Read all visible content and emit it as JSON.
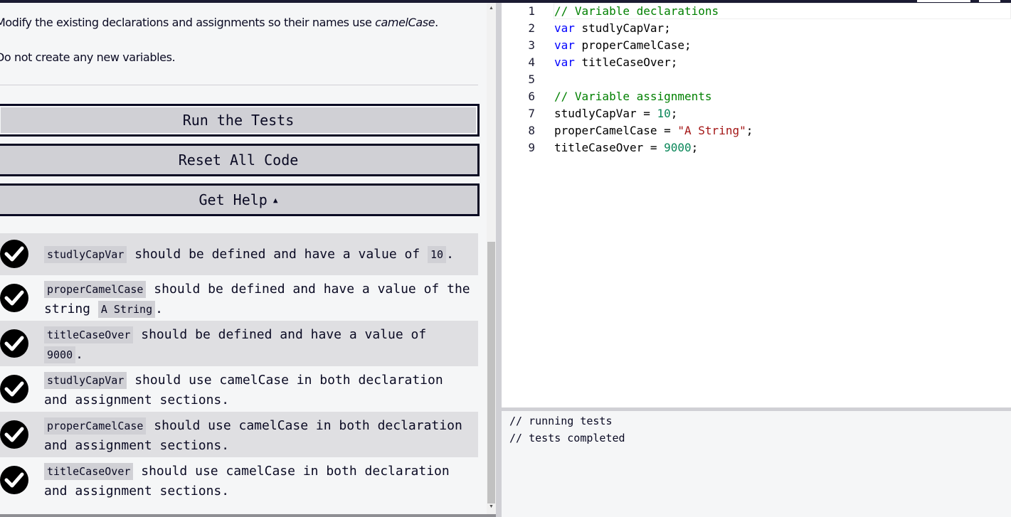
{
  "description": {
    "line1_prefix": "Modify the existing declarations and assignments so their names use ",
    "line1_em": "camelCase",
    "line1_suffix": ".",
    "line2": "Do not create any new variables."
  },
  "buttons": {
    "run": "Run the Tests",
    "reset": "Reset All Code",
    "help": "Get Help",
    "help_caret": "▲"
  },
  "tests": [
    {
      "status": "passed",
      "code1": "studlyCapVar",
      "text1": " should be defined and have a value of ",
      "code2": "10",
      "text2": "."
    },
    {
      "status": "passed",
      "code1": "properCamelCase",
      "text1": " should be defined and have a value of the string ",
      "code2": "A String",
      "text2": "."
    },
    {
      "status": "passed",
      "code1": "titleCaseOver",
      "text1": " should be defined and have a value of ",
      "code2": "9000",
      "text2": "."
    },
    {
      "status": "passed",
      "code1": "studlyCapVar",
      "text1": " should use camelCase in both declaration and assignment sections."
    },
    {
      "status": "passed",
      "code1": "properCamelCase",
      "text1": " should use camelCase in both declaration and assignment sections."
    },
    {
      "status": "passed",
      "code1": "titleCaseOver",
      "text1": " should use camelCase in both declaration and assignment sections."
    }
  ],
  "editor": {
    "line_numbers": [
      "1",
      "2",
      "3",
      "4",
      "5",
      "6",
      "7",
      "8",
      "9"
    ],
    "lines": [
      {
        "comment": "// Variable declarations"
      },
      {
        "kw": "var",
        "ident": " studlyCapVar",
        "semi": ";"
      },
      {
        "kw": "var",
        "ident": " properCamelCase",
        "semi": ";"
      },
      {
        "kw": "var",
        "ident": " titleCaseOver",
        "semi": ";"
      },
      {},
      {
        "comment": "// Variable assignments"
      },
      {
        "ident": "studlyCapVar = ",
        "num": "10",
        "semi": ";"
      },
      {
        "ident": "properCamelCase = ",
        "str": "\"A String\"",
        "semi": ";"
      },
      {
        "ident": "titleCaseOver = ",
        "num": "9000",
        "semi": ";"
      }
    ]
  },
  "console": {
    "lines": [
      "// running tests",
      "// tests completed"
    ]
  },
  "colors": {
    "nav": "#1b1b32",
    "panel": "#f5f6f7",
    "button": "#d0d0d5",
    "keyword": "#0000ff",
    "comment": "#008000",
    "number": "#098658",
    "string": "#a31515"
  },
  "icons": {
    "test_pass": "check-circle-icon",
    "help_caret": "caret-up-icon"
  }
}
